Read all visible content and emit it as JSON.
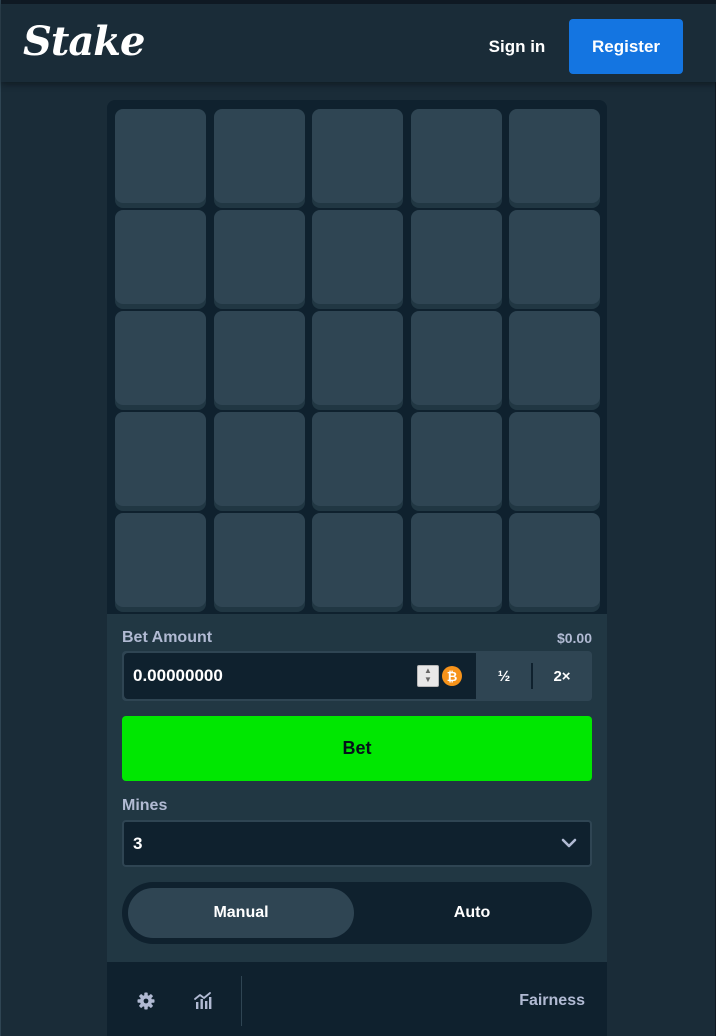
{
  "header": {
    "logo_text": "Stake",
    "signin_label": "Sign in",
    "register_label": "Register"
  },
  "board": {
    "rows": 5,
    "columns": 5,
    "tiles_revealed": 0
  },
  "controls": {
    "bet_amount_label": "Bet Amount",
    "bet_amount_usd": "$0.00",
    "bet_amount_value": "0.00000000",
    "currency_icon": "bitcoin-icon",
    "currency_symbol": "₿",
    "half_label": "½",
    "double_label": "2×",
    "bet_button_label": "Bet",
    "mines_label": "Mines",
    "mines_value": "3",
    "modes": {
      "manual": "Manual",
      "auto": "Auto",
      "active": "Manual"
    }
  },
  "footer": {
    "settings_icon": "gear-icon",
    "stats_icon": "stats-chart-icon",
    "fairness_label": "Fairness"
  },
  "colors": {
    "background": "#1a2c38",
    "panel": "#213743",
    "dark": "#0f212e",
    "tile": "#2f4553",
    "bet_green": "#00e701",
    "register_blue": "#1475e1",
    "muted_text": "#b1bad3"
  }
}
